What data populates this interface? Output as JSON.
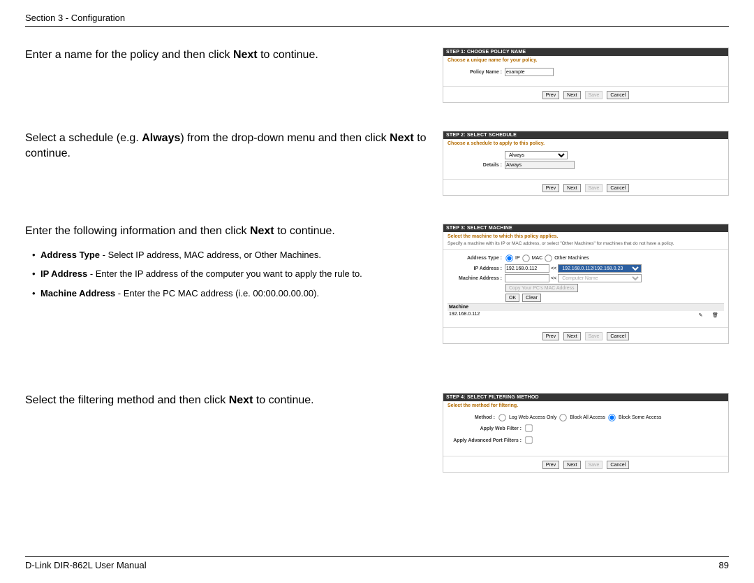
{
  "header": {
    "breadcrumb": "Section 3 - Configuration"
  },
  "footer": {
    "manual": "D-Link DIR-862L User Manual",
    "page": "89"
  },
  "row1": {
    "instr_pre": "Enter a name for the policy and then click ",
    "instr_bold": "Next",
    "instr_post": " to continue.",
    "shot": {
      "title": "STEP 1: CHOOSE POLICY NAME",
      "note": "Choose a unique name for your policy.",
      "label": "Policy Name :",
      "value": "example",
      "btns": {
        "prev": "Prev",
        "next": "Next",
        "save": "Save",
        "cancel": "Cancel"
      }
    }
  },
  "row2": {
    "instr_pre": "Select a schedule (e.g. ",
    "instr_bold1": "Always",
    "instr_mid": ") from the drop-down menu and then click ",
    "instr_bold2": "Next",
    "instr_post": " to continue.",
    "shot": {
      "title": "STEP 2: SELECT SCHEDULE",
      "note": "Choose a schedule to apply to this policy.",
      "sel": "Always",
      "details_label": "Details :",
      "details_val": "Always",
      "btns": {
        "prev": "Prev",
        "next": "Next",
        "save": "Save",
        "cancel": "Cancel"
      }
    }
  },
  "row3": {
    "instr_pre": "Enter the following information and then click ",
    "instr_bold": "Next",
    "instr_post": " to continue.",
    "bullets": {
      "b1_lead": "Address Type",
      "b1_rest": " - Select IP address, MAC address, or Other Machines.",
      "b2_lead": "IP Address",
      "b2_rest": " - Enter the IP address of the computer you want to apply the rule to.",
      "b3_lead": "Machine Address",
      "b3_rest": " - Enter the PC MAC address (i.e. 00:00.00.00.00)."
    },
    "shot": {
      "title": "STEP 3: SELECT MACHINE",
      "note": "Select the machine to which this policy applies.",
      "spec": "Specify a machine with its IP or MAC address, or select \"Other Machines\" for machines that do not have a policy.",
      "addr_type_label": "Address Type :",
      "addr_ip": "IP",
      "addr_mac": "MAC",
      "addr_other": "Other Machines",
      "ip_label": "IP Address :",
      "ip_val": "192.168.0.112",
      "ip_sel_prefix": "<<",
      "ip_sel": "192.168.0.112/192.168.0.23",
      "mach_label": "Machine Address :",
      "mach_sel": "Computer Name",
      "copy_btn": "Copy Your PC's MAC Address",
      "ok": "OK",
      "clear": "Clear",
      "tbl_head": "Machine",
      "tbl_ip": "192.168.0.112",
      "edit_icon": "✎",
      "del_icon": "🗑",
      "btns": {
        "prev": "Prev",
        "next": "Next",
        "save": "Save",
        "cancel": "Cancel"
      }
    }
  },
  "row4": {
    "instr_pre": "Select the filtering method and then click ",
    "instr_bold": "Next",
    "instr_post": " to continue.",
    "shot": {
      "title": "STEP 4: SELECT FILTERING METHOD",
      "note": "Select the method for filtering.",
      "method_label": "Method :",
      "m1": "Log Web Access Only",
      "m2": "Block All Access",
      "m3": "Block Some Access",
      "apply_web_label": "Apply Web Filter :",
      "apply_port_label": "Apply Advanced Port Filters :",
      "btns": {
        "prev": "Prev",
        "next": "Next",
        "save": "Save",
        "cancel": "Cancel"
      }
    }
  }
}
